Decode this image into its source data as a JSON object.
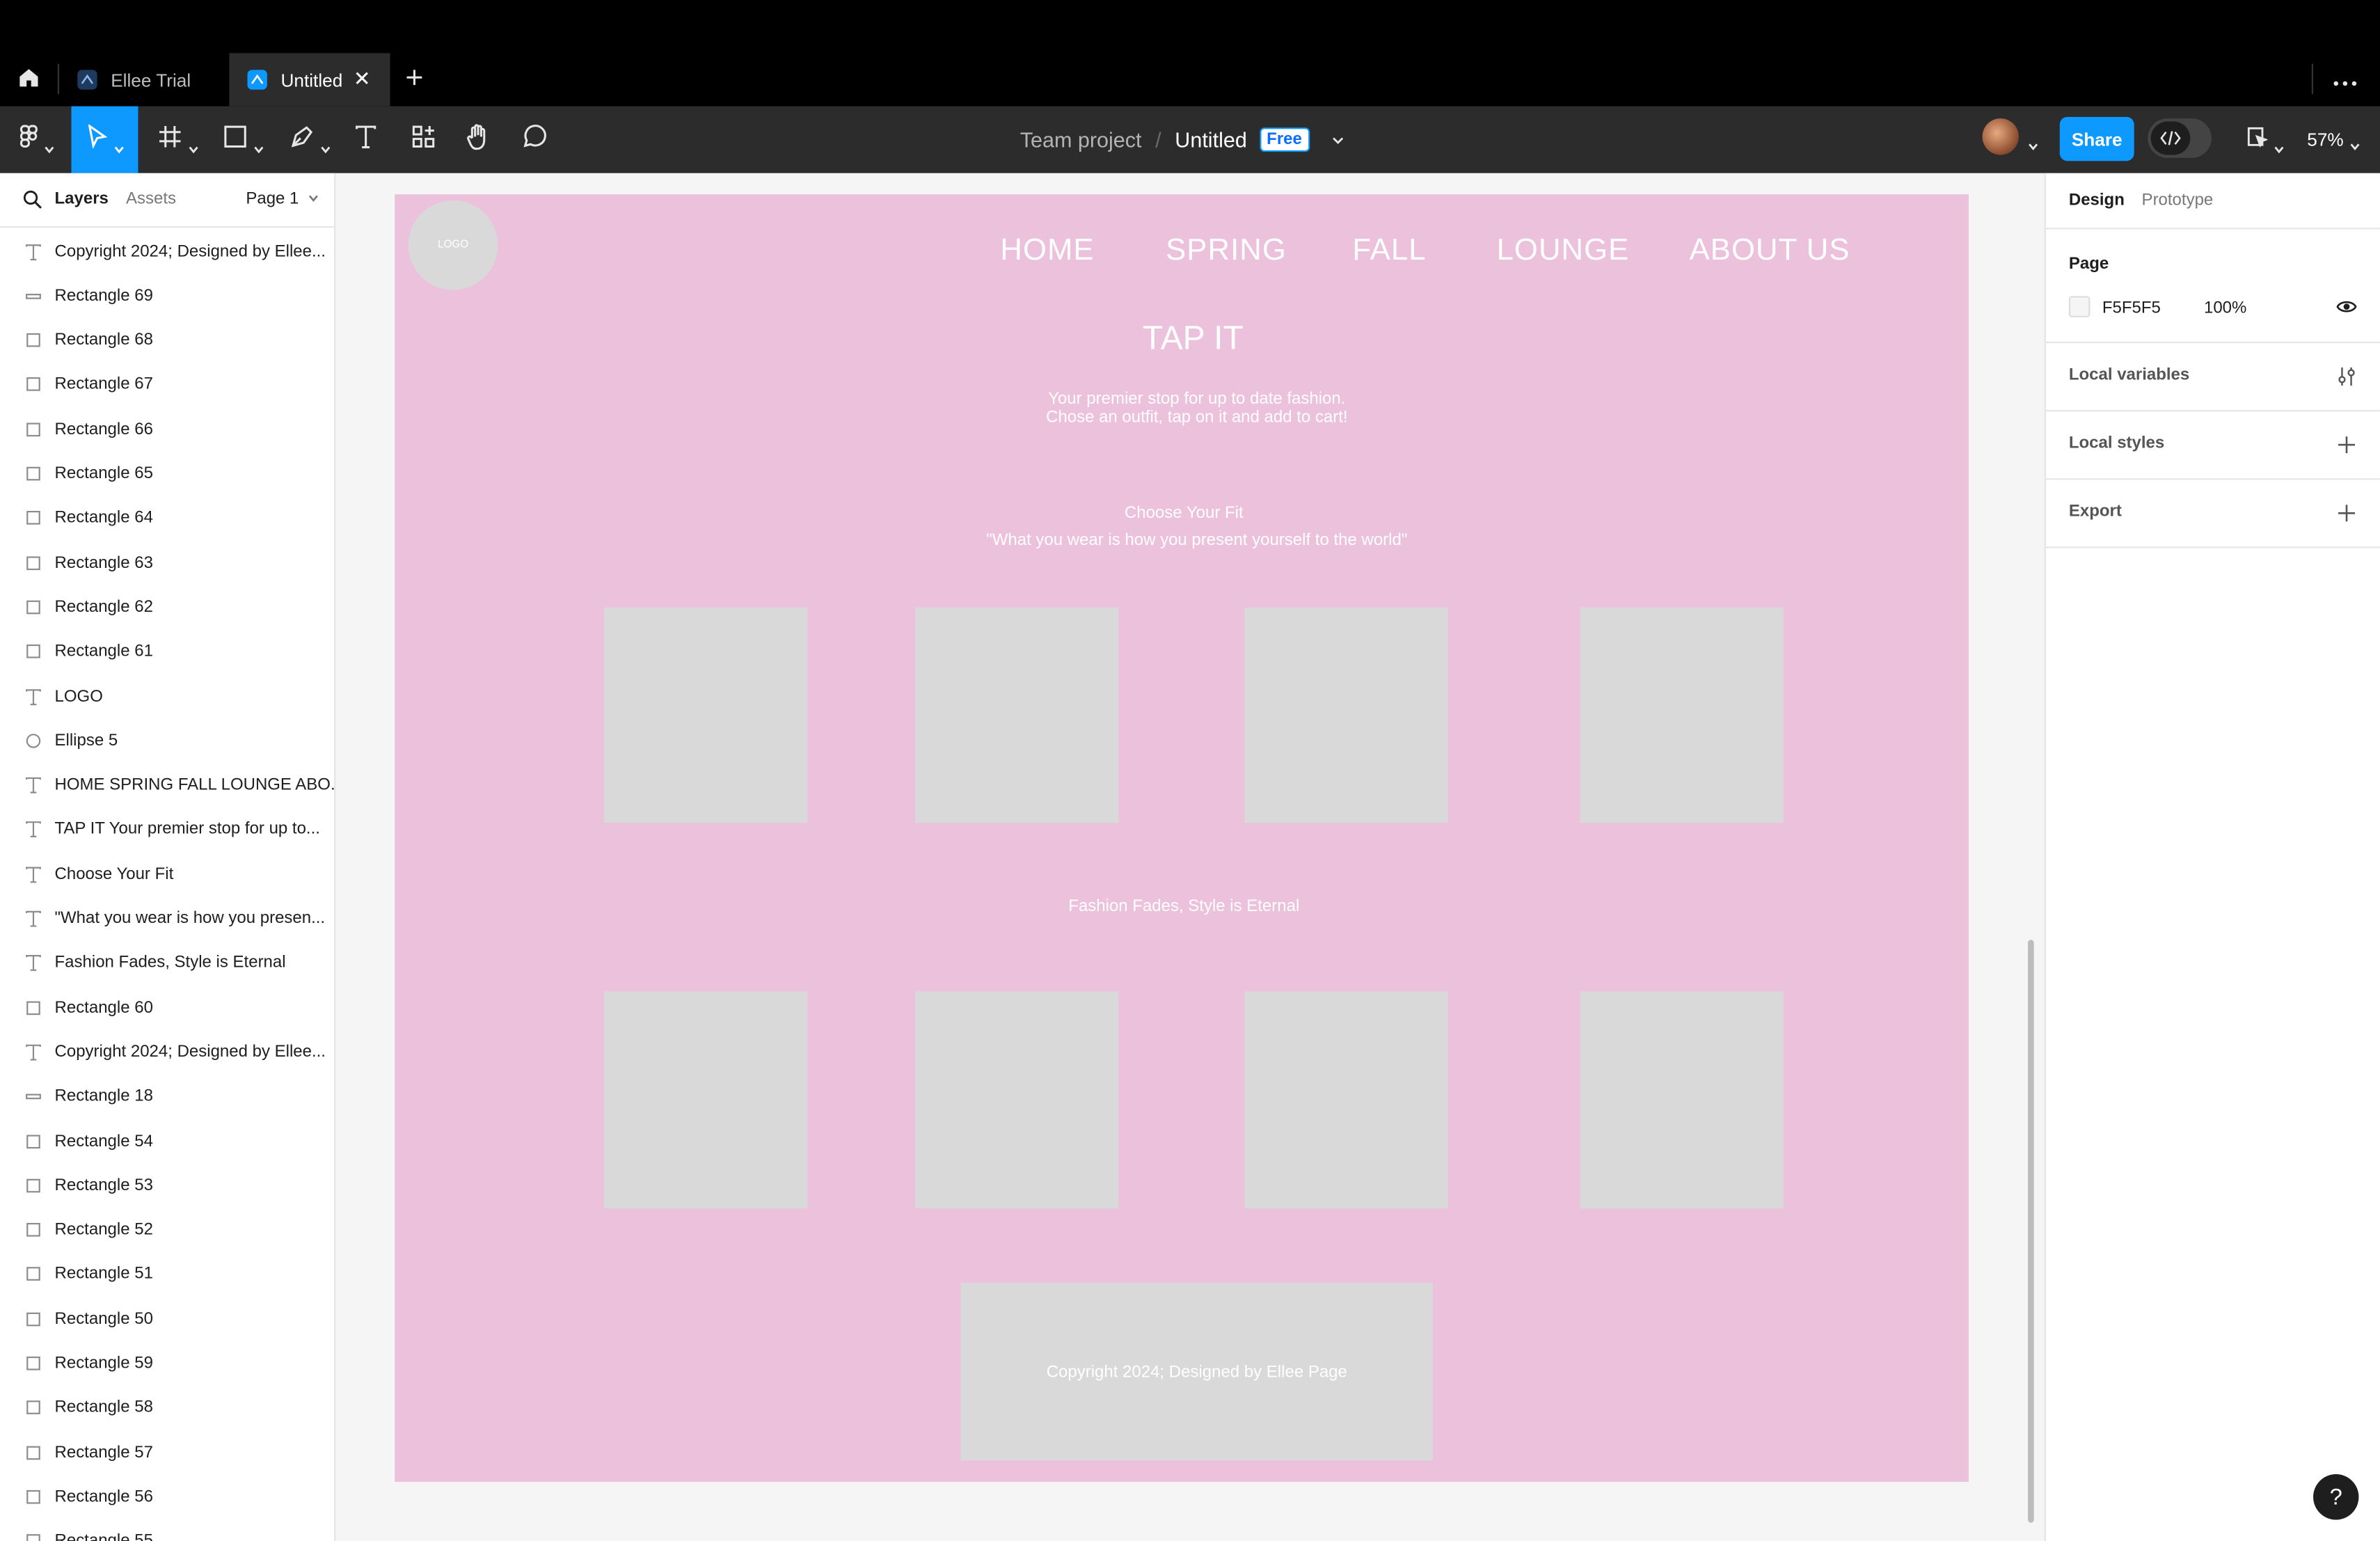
{
  "tabs": [
    {
      "label": "Ellee Trial",
      "active": false
    },
    {
      "label": "Untitled",
      "active": true
    }
  ],
  "toolbar": {
    "project": "Team project",
    "file": "Untitled",
    "plan_badge": "Free",
    "share_label": "Share",
    "zoom": "57%"
  },
  "left_panel": {
    "tab_layers": "Layers",
    "tab_assets": "Assets",
    "page_selector": "Page 1",
    "layers": [
      {
        "icon": "text",
        "name": "Copyright 2024; Designed by Ellee..."
      },
      {
        "icon": "line",
        "name": "Rectangle 69"
      },
      {
        "icon": "rect",
        "name": "Rectangle 68"
      },
      {
        "icon": "rect",
        "name": "Rectangle 67"
      },
      {
        "icon": "rect",
        "name": "Rectangle 66"
      },
      {
        "icon": "rect",
        "name": "Rectangle 65"
      },
      {
        "icon": "rect",
        "name": "Rectangle 64"
      },
      {
        "icon": "rect",
        "name": "Rectangle 63"
      },
      {
        "icon": "rect",
        "name": "Rectangle 62"
      },
      {
        "icon": "rect",
        "name": "Rectangle 61"
      },
      {
        "icon": "text",
        "name": "LOGO"
      },
      {
        "icon": "ellipse",
        "name": "Ellipse 5"
      },
      {
        "icon": "text",
        "name": "HOME SPRING FALL LOUNGE ABO..."
      },
      {
        "icon": "text",
        "name": "TAP IT Your premier stop for up to..."
      },
      {
        "icon": "text",
        "name": "Choose Your Fit"
      },
      {
        "icon": "text",
        "name": "\"What you wear is how you presen..."
      },
      {
        "icon": "text",
        "name": "Fashion Fades, Style is Eternal"
      },
      {
        "icon": "rect",
        "name": "Rectangle 60"
      },
      {
        "icon": "text",
        "name": "Copyright 2024; Designed by Ellee..."
      },
      {
        "icon": "line",
        "name": "Rectangle 18"
      },
      {
        "icon": "rect",
        "name": "Rectangle 54"
      },
      {
        "icon": "rect",
        "name": "Rectangle 53"
      },
      {
        "icon": "rect",
        "name": "Rectangle 52"
      },
      {
        "icon": "rect",
        "name": "Rectangle 51"
      },
      {
        "icon": "rect",
        "name": "Rectangle 50"
      },
      {
        "icon": "rect",
        "name": "Rectangle 59"
      },
      {
        "icon": "rect",
        "name": "Rectangle 58"
      },
      {
        "icon": "rect",
        "name": "Rectangle 57"
      },
      {
        "icon": "rect",
        "name": "Rectangle 56"
      },
      {
        "icon": "rect",
        "name": "Rectangle 55"
      }
    ]
  },
  "frame": {
    "background": "#ecc1dc",
    "logo": "LOGO",
    "nav": [
      "HOME",
      "SPRING",
      "FALL",
      "LOUNGE",
      "ABOUT US"
    ],
    "title": "TAP IT",
    "tagline_1": "Your premier stop for up to date fashion.",
    "tagline_2": "Chose an outfit, tap on it and add to cart!",
    "section_title": "Choose Your Fit",
    "quote": "\"What you wear is how you present yourself to the world\"",
    "section_2": "Fashion Fades, Style is Eternal",
    "footer": "Copyright 2024; Designed by Ellee Page"
  },
  "right_panel": {
    "tab_design": "Design",
    "tab_prototype": "Prototype",
    "page_label": "Page",
    "page_color": "F5F5F5",
    "page_opacity": "100%",
    "local_variables": "Local variables",
    "local_styles": "Local styles",
    "export": "Export"
  },
  "help": "?"
}
